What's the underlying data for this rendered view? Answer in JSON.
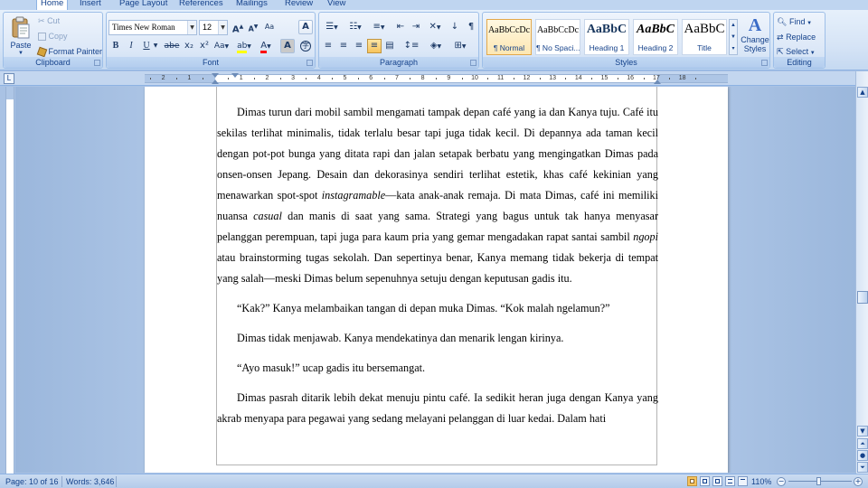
{
  "tabs": [
    {
      "label": "Home",
      "active": true
    },
    {
      "label": "Insert",
      "active": false
    },
    {
      "label": "Page Layout",
      "active": false
    },
    {
      "label": "References",
      "active": false
    },
    {
      "label": "Mailings",
      "active": false
    },
    {
      "label": "Review",
      "active": false
    },
    {
      "label": "View",
      "active": false
    }
  ],
  "clipboard": {
    "label": "Clipboard",
    "paste": "Paste",
    "cut": "Cut",
    "copy": "Copy",
    "format_painter": "Format Painter"
  },
  "font": {
    "label": "Font",
    "family": "Times New Roman",
    "size": "12",
    "grow": "A",
    "shrink": "A",
    "clear": "Aa",
    "bold": "B",
    "italic": "I",
    "underline": "U",
    "strike": "abe",
    "subscript": "x₂",
    "superscript": "x²",
    "change_case": "Aa",
    "highlight": "ab",
    "font_color": "A",
    "highlight_color": "#ffff00",
    "font_color_value": "#ff0000"
  },
  "paragraph": {
    "label": "Paragraph"
  },
  "styles": {
    "label": "Styles",
    "items": [
      {
        "preview": "AaBbCcDc",
        "name": "¶ Normal",
        "selected": true
      },
      {
        "preview": "AaBbCcDc",
        "name": "¶ No Spaci...",
        "selected": false
      },
      {
        "preview": "AaBbC",
        "name": "Heading 1",
        "selected": false
      },
      {
        "preview": "AaBbC",
        "name": "Heading 2",
        "selected": false
      },
      {
        "preview": "AaBbC",
        "name": "Title",
        "selected": false
      }
    ],
    "change_styles": "Change Styles"
  },
  "editing": {
    "label": "Editing",
    "find": "Find",
    "replace": "Replace",
    "select": "Select"
  },
  "ruler": {
    "numbers": [
      "2",
      "1",
      "1",
      "2",
      "3",
      "4",
      "5",
      "6",
      "7",
      "8",
      "9",
      "10",
      "11",
      "12",
      "13",
      "14",
      "15",
      "16",
      "17",
      "18"
    ]
  },
  "document": {
    "paragraphs": [
      {
        "runs": [
          {
            "text": "Dimas turun dari mobil sambil mengamati tampak depan café yang ia dan Kanya tuju. Café itu sekilas terlihat minimalis, tidak terlalu besar tapi juga tidak kecil. Di depannya ada taman kecil dengan pot-pot bunga yang ditata rapi dan jalan setapak berbatu yang mengingatkan Dimas pada onsen-onsen Jepang. Desain dan dekorasinya sendiri terlihat estetik, khas café kekinian yang menawarkan spot-spot "
          },
          {
            "text": "instagramable",
            "italic": true
          },
          {
            "text": "—kata anak-anak remaja. Di mata Dimas, café ini memiliki nuansa "
          },
          {
            "text": "casual",
            "italic": true
          },
          {
            "text": " dan manis di saat yang sama. Strategi yang bagus untuk tak hanya menyasar pelanggan perempuan, tapi juga para kaum pria yang gemar mengadakan rapat santai sambil "
          },
          {
            "text": "ngopi",
            "italic": true
          },
          {
            "text": " atau brainstorming tugas sekolah. Dan sepertinya benar, Kanya memang tidak bekerja di tempat yang salah—meski Dimas belum sepenuhnya setuju dengan keputusan gadis itu."
          }
        ]
      },
      {
        "runs": [
          {
            "text": "“Kak?” Kanya melambaikan tangan di depan muka Dimas. “Kok malah ngelamun?”"
          }
        ]
      },
      {
        "runs": [
          {
            "text": "Dimas tidak menjawab. Kanya mendekatinya dan menarik lengan kirinya."
          }
        ]
      },
      {
        "runs": [
          {
            "text": "“Ayo masuk!” ucap gadis itu bersemangat."
          }
        ]
      },
      {
        "runs": [
          {
            "text": "Dimas pasrah ditarik lebih dekat menuju pintu café. Ia sedikit heran juga dengan Kanya yang akrab menyapa para pegawai yang sedang melayani pelanggan di luar kedai. Dalam hati"
          }
        ]
      }
    ]
  },
  "status": {
    "page": "Page: 10 of 16",
    "words": "Words: 3,646",
    "zoom": "110%",
    "zoom_out": "−",
    "zoom_in": "+"
  }
}
